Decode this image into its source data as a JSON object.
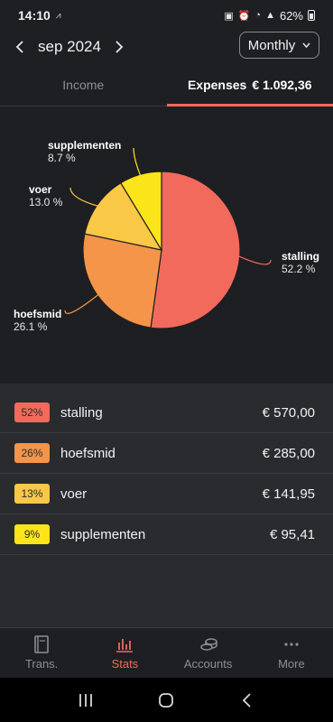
{
  "status": {
    "time": "14:10",
    "left_icon": "signal-icon",
    "battery_text": "62%"
  },
  "header": {
    "month": "sep 2024",
    "period": "Monthly"
  },
  "tabs": {
    "income_label": "Income",
    "expenses_label": "Expenses",
    "expenses_total": "€ 1.092,36"
  },
  "chart_data": {
    "type": "pie",
    "slices": [
      {
        "label": "stalling",
        "percent_label": "52.2 %",
        "value": 52.2,
        "color": "#f26a5c"
      },
      {
        "label": "hoefsmid",
        "percent_label": "26.1 %",
        "value": 26.1,
        "color": "#f5954a"
      },
      {
        "label": "voer",
        "percent_label": "13.0 %",
        "value": 13.0,
        "color": "#f9c847"
      },
      {
        "label": "supplementen",
        "percent_label": "8.7 %",
        "value": 8.7,
        "color": "#fbe51a"
      }
    ]
  },
  "categories": [
    {
      "badge": "52%",
      "name": "stalling",
      "amount": "€ 570,00",
      "color": "#f26a5c"
    },
    {
      "badge": "26%",
      "name": "hoefsmid",
      "amount": "€ 285,00",
      "color": "#f5954a"
    },
    {
      "badge": "13%",
      "name": "voer",
      "amount": "€ 141,95",
      "color": "#f9c847"
    },
    {
      "badge": "9%",
      "name": "supplementen",
      "amount": "€ 95,41",
      "color": "#fbe51a"
    }
  ],
  "nav": {
    "trans": "Trans.",
    "stats": "Stats",
    "accounts": "Accounts",
    "more": "More"
  }
}
